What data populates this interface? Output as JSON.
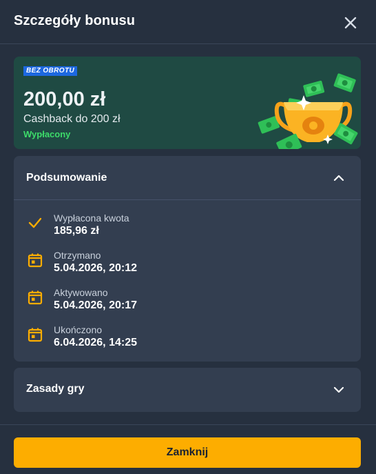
{
  "header": {
    "title": "Szczegóły bonusu"
  },
  "banner": {
    "badge": "BEZ OBROTU",
    "amount": "200,00 zł",
    "subtitle": "Cashback do 200 zł",
    "status": "Wypłacony"
  },
  "summary": {
    "title": "Podsumowanie",
    "items": [
      {
        "label": "Wypłacona kwota",
        "value": "185,96 zł",
        "icon": "check-icon"
      },
      {
        "label": "Otrzymano",
        "value": "5.04.2026, 20:12",
        "icon": "calendar-icon"
      },
      {
        "label": "Aktywowano",
        "value": "5.04.2026, 20:17",
        "icon": "calendar-icon"
      },
      {
        "label": "Ukończono",
        "value": "6.04.2026, 14:25",
        "icon": "calendar-icon"
      }
    ]
  },
  "rules": {
    "title": "Zasady gry"
  },
  "footer": {
    "close_label": "Zamknij"
  },
  "colors": {
    "accent": "#fdad00",
    "badge": "#1d68e0",
    "status": "#3ddc6a",
    "banner_bg": "#1f4a43"
  }
}
